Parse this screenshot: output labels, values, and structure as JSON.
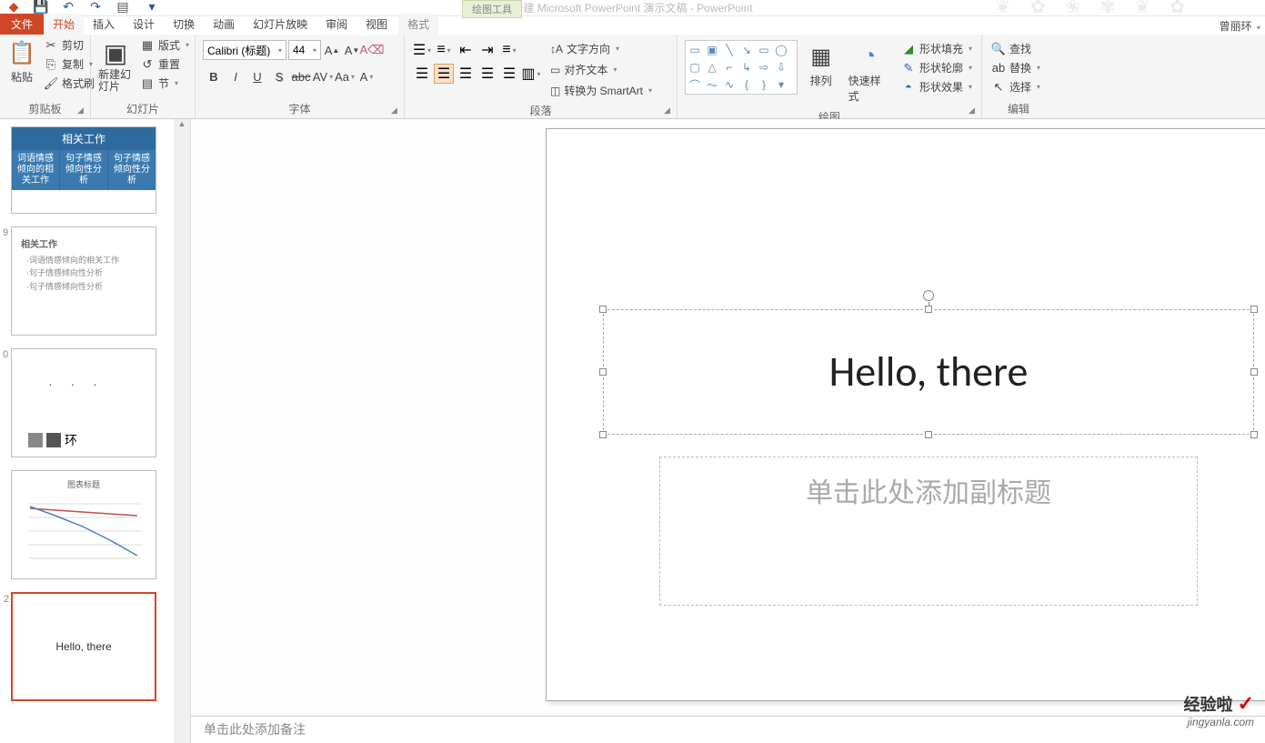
{
  "titlebar": {
    "doc_title": "新建 Microsoft PowerPoint 演示文稿 - PowerPoint",
    "user": "曾丽环"
  },
  "tool_context": "绘图工具",
  "tabs": {
    "file": "文件",
    "home": "开始",
    "insert": "插入",
    "design": "设计",
    "transitions": "切换",
    "animations": "动画",
    "slideshow": "幻灯片放映",
    "review": "审阅",
    "view": "视图",
    "format": "格式"
  },
  "ribbon": {
    "clipboard": {
      "label": "剪贴板",
      "paste": "粘贴",
      "cut": "剪切",
      "copy": "复制",
      "format_painter": "格式刷"
    },
    "slides": {
      "label": "幻灯片",
      "new_slide": "新建幻灯片",
      "layout": "版式",
      "reset": "重置",
      "section": "节"
    },
    "font": {
      "label": "字体",
      "name": "Calibri (标题)",
      "size": "44"
    },
    "paragraph": {
      "label": "段落",
      "text_direction": "文字方向",
      "align_text": "对齐文本",
      "smartart": "转换为 SmartArt"
    },
    "drawing": {
      "label": "绘图",
      "arrange": "排列",
      "quick_styles": "快速样式",
      "fill": "形状填充",
      "outline": "形状轮廓",
      "effects": "形状效果"
    },
    "editing": {
      "label": "编辑",
      "find": "查找",
      "replace": "替换",
      "select": "选择"
    }
  },
  "thumbs": {
    "t1": {
      "header": "相关工作",
      "c1": "词语情感倾向的相关工作",
      "c2": "句子情感倾向性分析",
      "c3": "句子情感倾向性分析"
    },
    "t2": {
      "title": "相关工作",
      "li1": "·词语情感倾向的相关工作",
      "li2": "·句子情感倾向性分析",
      "li3": "·句子情感倾向性分析"
    },
    "t3": {
      "env_text": "环"
    },
    "t4": {
      "chart_title": "图表标题"
    },
    "t5": {
      "text": "Hello, there"
    }
  },
  "slide": {
    "title": "Hello, there",
    "subtitle_placeholder": "单击此处添加副标题"
  },
  "notes_placeholder": "单击此处添加备注",
  "watermark": {
    "line1": "经验啦",
    "line2": "jingyanla.com"
  }
}
